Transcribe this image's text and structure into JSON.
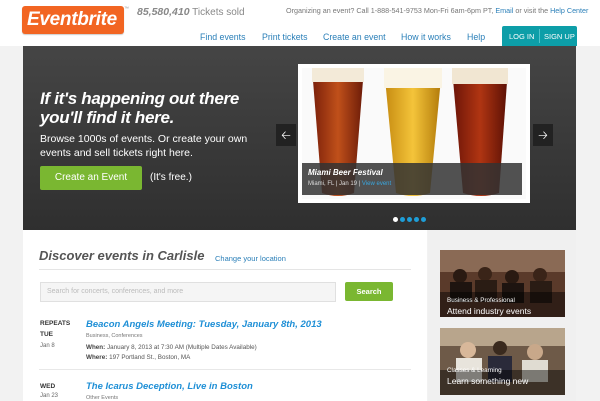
{
  "header": {
    "logo": "Eventbrite",
    "tickets_count": "85,580,410",
    "tickets_label": "Tickets sold",
    "help_text": "Organizing an event? Call 1-888-541-9753 Mon-Fri 6am-6pm PT,",
    "email_link": "Email",
    "help_or": "or visit the",
    "help_center_link": "Help Center",
    "nav": [
      "Find events",
      "Print tickets",
      "Create an event",
      "How it works",
      "Help"
    ],
    "login": "LOG IN",
    "signup": "SIGN UP"
  },
  "hero": {
    "title": "If it's happening out there you'll find it here.",
    "subtitle": "Browse 1000s of events. Or create your own events and sell tickets right here.",
    "cta": "Create an Event",
    "cta_note": "(It's free.)",
    "slide": {
      "title": "Miami Beer Festival",
      "meta": "Miami, FL | Jan 19 |",
      "link": "View event"
    },
    "slide_count": 5,
    "active_slide": 1
  },
  "discover": {
    "heading": "Discover events in Carlisle",
    "change_location": "Change your location",
    "search_placeholder": "Search for concerts, conferences, and more",
    "search_button": "Search",
    "events": [
      {
        "repeats": "REPEATS",
        "day": "TUE",
        "date": "Jan 8",
        "title": "Beacon Angels Meeting: Tuesday, January 8th, 2013",
        "category": "Business, Conferences",
        "when_label": "When:",
        "when": "January 8, 2013 at 7:30 AM (Multiple Dates Available)",
        "where_label": "Where:",
        "where": "197 Portland St., Boston, MA"
      },
      {
        "day": "WED",
        "date": "Jan 23",
        "title": "The Icarus Deception, Live in Boston",
        "category": "Other Events"
      }
    ]
  },
  "sidebar": {
    "cards": [
      {
        "label": "Business & Professional",
        "text": "Attend industry events"
      },
      {
        "label": "Classes & Learning",
        "text": "Learn something new"
      }
    ]
  },
  "colors": {
    "brand_orange": "#f26522",
    "link_blue": "#2a7fb8",
    "cta_green": "#7ab731",
    "auth_teal": "#0d9ea8"
  }
}
